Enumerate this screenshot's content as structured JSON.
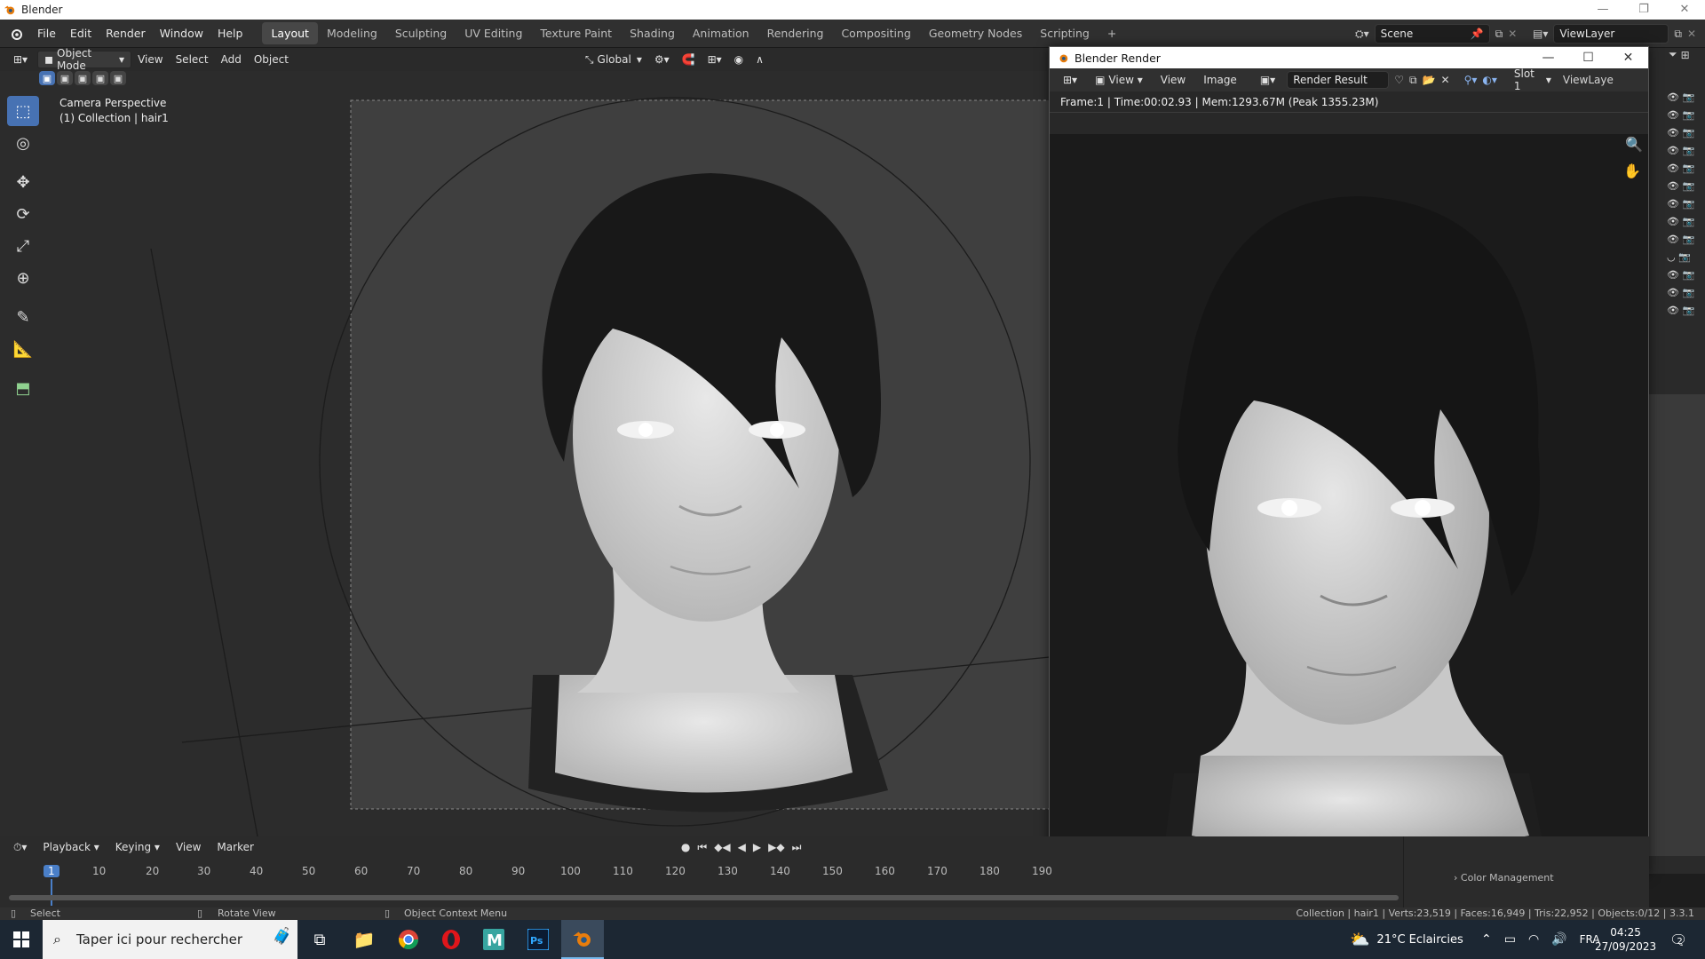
{
  "window": {
    "title": "Blender"
  },
  "menus": [
    "File",
    "Edit",
    "Render",
    "Window",
    "Help"
  ],
  "workspaces": [
    "Layout",
    "Modeling",
    "Sculpting",
    "UV Editing",
    "Texture Paint",
    "Shading",
    "Animation",
    "Rendering",
    "Compositing",
    "Geometry Nodes",
    "Scripting"
  ],
  "active_workspace": "Layout",
  "add_workspace": "+",
  "scene": {
    "name": "Scene"
  },
  "view_layer": {
    "name": "ViewLayer"
  },
  "viewport_header": {
    "mode": "Object Mode",
    "menus": [
      "View",
      "Select",
      "Add",
      "Object"
    ],
    "orientation": "Global"
  },
  "viewport_overlay": {
    "camera": "Camera Perspective",
    "collection": "(1) Collection | hair1"
  },
  "render_window": {
    "title": "Blender Render",
    "view_menu": "View",
    "menus": [
      "View",
      "Image"
    ],
    "image_name": "Render Result",
    "slot": "Slot 1",
    "view_layer": "ViewLaye",
    "info": "Frame:1 | Time:00:02.93 | Mem:1293.67M (Peak 1355.23M)"
  },
  "timeline": {
    "menus": [
      "Playback",
      "Keying",
      "View",
      "Marker"
    ],
    "current_frame": "1",
    "ticks": [
      "10",
      "20",
      "30",
      "40",
      "50",
      "60",
      "70",
      "80",
      "90",
      "100",
      "110",
      "120",
      "130",
      "140",
      "150",
      "160",
      "170",
      "180",
      "190"
    ]
  },
  "properties_partial": {
    "color_management": "Color Management"
  },
  "statusbar": {
    "select": "Select",
    "rotate": "Rotate View",
    "context": "Object Context Menu",
    "stats": "Collection | hair1 | Verts:23,519 | Faces:16,949 | Tris:22,952 | Objects:0/12 | 3.3.1"
  },
  "taskbar": {
    "search_placeholder": "Taper ici pour rechercher",
    "weather": "21°C  Eclaircies",
    "language": "FRA",
    "time": "04:25",
    "date": "27/09/2023",
    "notifications": "2"
  },
  "colors": {
    "accent": "#4772b3",
    "playhead": "#4a7fc8",
    "panel": "#303030",
    "viewport_bg": "#3d3d3d"
  }
}
